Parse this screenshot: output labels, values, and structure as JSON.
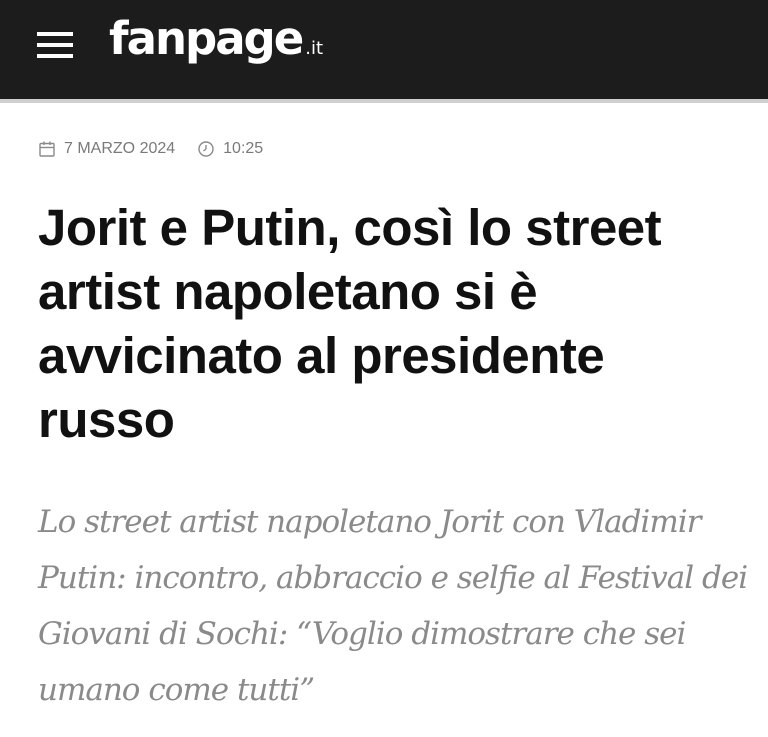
{
  "header": {
    "logo_main": "fanpage",
    "logo_tld": ".it",
    "menu_icon": "hamburger-menu-icon",
    "background_color": "#1c1c1c"
  },
  "meta": {
    "date": "7 MARZO 2024",
    "time": "10:25",
    "date_icon": "calendar-icon",
    "time_icon": "clock-icon"
  },
  "article": {
    "headline": "Jorit e Putin, così lo street artist napoletano si è avvicinato al presidente russo",
    "summary": "Lo street artist napoletano Jorit con Vladimir Putin: incontro, abbraccio e selfie al Festival dei Giovani di Sochi: “Voglio dimostrare che sei umano come tutti”"
  }
}
